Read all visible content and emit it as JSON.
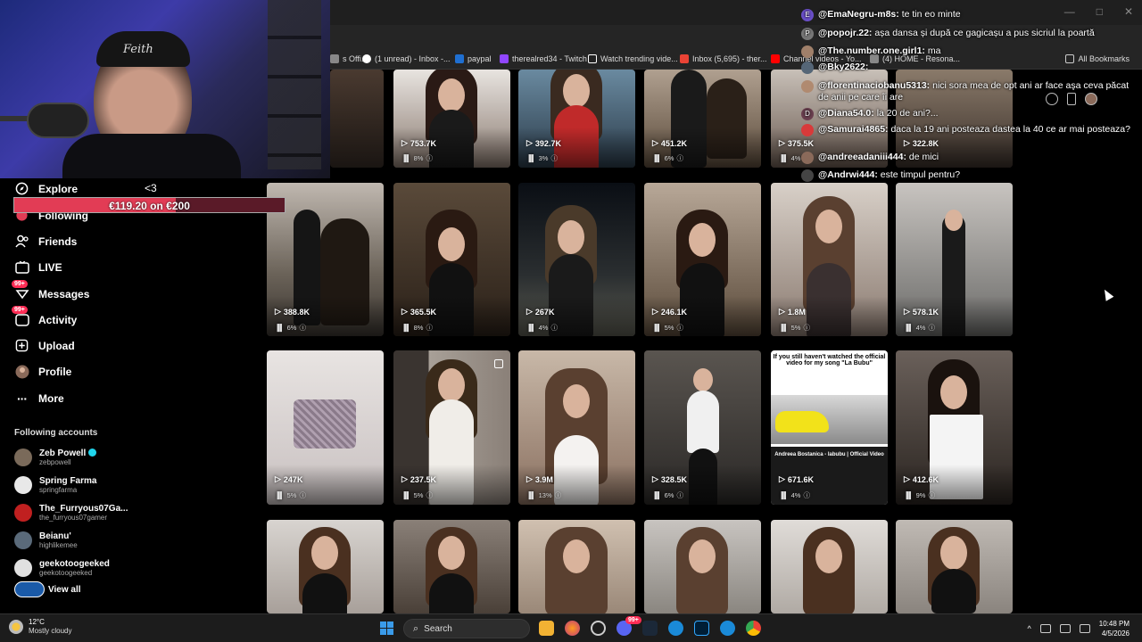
{
  "browser": {
    "bookmarks": [
      {
        "label": "s Offi...",
        "color": "#888888"
      },
      {
        "label": "(1 unread) - Inbox -...",
        "color": "#ffffff"
      },
      {
        "label": "paypal",
        "color": "#1f6fd1"
      },
      {
        "label": "therealred34 - Twitch",
        "color": "#9146ff"
      },
      {
        "label": "Watch trending vide...",
        "color": "#000000"
      },
      {
        "label": "Inbox (5,695) - ther...",
        "color": "#ea4335"
      },
      {
        "label": "Channel videos - Yo...",
        "color": "#ff0000"
      },
      {
        "label": "(4) HOME - Resona...",
        "color": "#888888"
      }
    ],
    "all_bookmarks": "All Bookmarks",
    "window_controls": [
      "—",
      "□",
      "✕"
    ]
  },
  "donation": {
    "label": "€119.20 on €200",
    "progress": 0.596
  },
  "sidebar": {
    "items": [
      {
        "label": "Explore",
        "icon": "compass-icon"
      },
      {
        "label": "Following",
        "icon": "following-icon"
      },
      {
        "label": "Friends",
        "icon": "friends-icon"
      },
      {
        "label": "LIVE",
        "icon": "live-icon"
      },
      {
        "label": "Messages",
        "icon": "messages-icon",
        "badge": "99+"
      },
      {
        "label": "Activity",
        "icon": "activity-icon",
        "badge": "99+"
      },
      {
        "label": "Upload",
        "icon": "upload-icon"
      },
      {
        "label": "Profile",
        "icon": "profile-icon"
      },
      {
        "label": "More",
        "icon": "more-icon"
      }
    ],
    "following_title": "Following accounts",
    "accounts": [
      {
        "name": "Zeb Powell",
        "handle": "zebpowell",
        "verified": true,
        "color": "#7a6a5a"
      },
      {
        "name": "Spring Farma",
        "handle": "springfarma",
        "verified": false,
        "color": "#e8e8e8"
      },
      {
        "name": "The_Furryous07Ga...",
        "handle": "the_furryous07gamer",
        "verified": false,
        "color": "#c02020"
      },
      {
        "name": "Beianu'",
        "handle": "highlikemee",
        "verified": false,
        "color": "#5a6a7a"
      },
      {
        "name": "geekotoogeeked",
        "handle": "geekotoogeeked",
        "verified": false,
        "color": "#e0e0e0"
      }
    ],
    "view_all": "View all"
  },
  "videos": [
    {
      "views": "753.7K",
      "pct": "8%"
    },
    {
      "views": "392.7K",
      "pct": "3%"
    },
    {
      "views": "451.2K",
      "pct": "6%"
    },
    {
      "views": "375.5K",
      "pct": "4%"
    },
    {
      "views": "322.8K",
      "pct": ""
    },
    {
      "views": "388.8K",
      "pct": "6%"
    },
    {
      "views": "365.5K",
      "pct": "8%"
    },
    {
      "views": "267K",
      "pct": "4%"
    },
    {
      "views": "246.1K",
      "pct": "5%"
    },
    {
      "views": "1.8M",
      "pct": "5%"
    },
    {
      "views": "578.1K",
      "pct": "4%"
    },
    {
      "views": "247K",
      "pct": "5%"
    },
    {
      "views": "237.5K",
      "pct": "5%"
    },
    {
      "views": "3.9M",
      "pct": "13%"
    },
    {
      "views": "328.5K",
      "pct": "6%"
    },
    {
      "views": "671.6K",
      "pct": "4%"
    },
    {
      "views": "412.6K",
      "pct": "9%"
    }
  ],
  "tile_texts": {
    "labubu_top": "If you still haven't watched the official video for my song \"La Bubu\"",
    "labubu_bottom": "Andreea Bostanica - labubu | Official Video"
  },
  "chat": [
    {
      "user": "@EmaNegru-m8s:",
      "text": "te tin eo minte",
      "avatar": "E",
      "color": "#6a4fc8"
    },
    {
      "user": "@popojr.22:",
      "text": "așa dansa și după ce gagicașu a pus sicriul la poartă",
      "avatar": "P",
      "color": "#777777"
    },
    {
      "user": "@The.number.one.girl1:",
      "text": "ma",
      "avatar": "",
      "color": "#a0806a"
    },
    {
      "user": "@Bky2622:",
      "text": "",
      "avatar": "",
      "color": "#556677"
    },
    {
      "user": "@florentinaciobanu5313:",
      "text": "nici sora mea de opt ani ar face aşa ceva păcat de anii pe care îi are",
      "avatar": "",
      "color": "#b08a70"
    },
    {
      "user": "@Diana54.0:",
      "text": "la 20 de ani?...",
      "avatar": "D",
      "color": "#6a3f4f"
    },
    {
      "user": "@Samurai4865:",
      "text": "daca la 19 ani posteaza dastea la 40 ce ar mai posteaza?",
      "avatar": "",
      "color": "#d83a3a"
    },
    {
      "user": "@andreeadaniii444:",
      "text": "de mici",
      "avatar": "",
      "color": "#8a6a5a"
    },
    {
      "user": "@Andrwi444:",
      "text": "este timpul pentru?",
      "avatar": "",
      "color": "#444444"
    }
  ],
  "taskbar": {
    "temp": "12°C",
    "condition": "Mostly cloudy",
    "search": "Search",
    "time": "10:48 PM",
    "date": "4/5/2026",
    "messenger_badge": "99+"
  }
}
